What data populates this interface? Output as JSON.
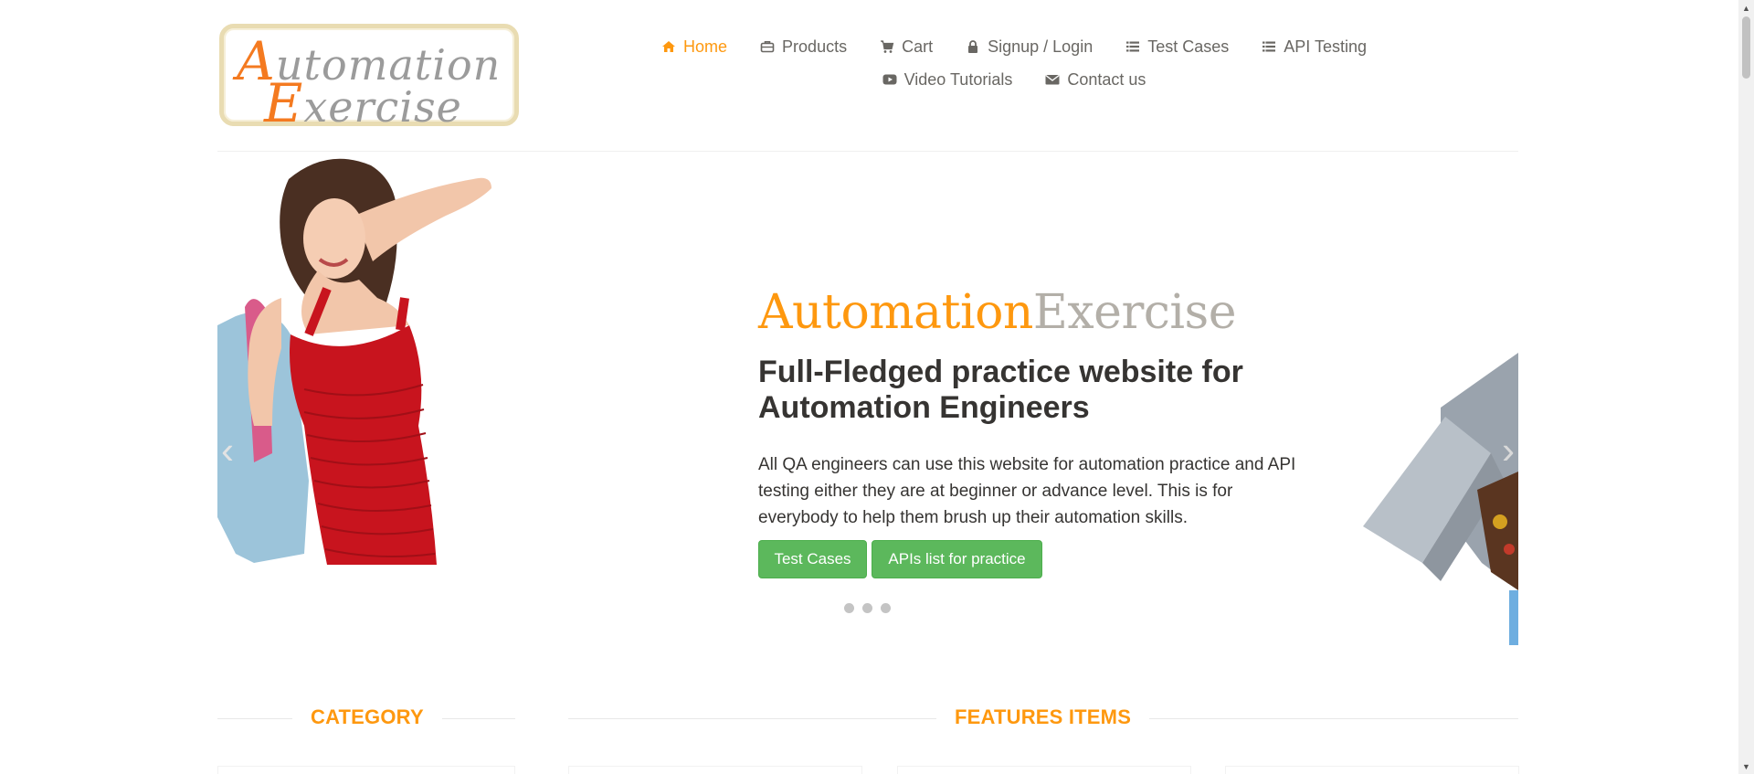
{
  "logo": {
    "line1_cap": "A",
    "line1_rest": "utomation",
    "line2_cap": "E",
    "line2_rest": "xercise"
  },
  "nav": {
    "row1": [
      {
        "label": "Home",
        "icon": "home-icon",
        "active": true
      },
      {
        "label": "Products",
        "icon": "briefcase-icon"
      },
      {
        "label": "Cart",
        "icon": "cart-icon"
      },
      {
        "label": "Signup / Login",
        "icon": "lock-icon"
      },
      {
        "label": "Test Cases",
        "icon": "list-icon"
      },
      {
        "label": "API Testing",
        "icon": "list-icon"
      }
    ],
    "row2": [
      {
        "label": "Video Tutorials",
        "icon": "youtube-icon"
      },
      {
        "label": "Contact us",
        "icon": "envelope-icon"
      }
    ]
  },
  "slider": {
    "brand_a": "Automation",
    "brand_b": "Exercise",
    "headline": "Full-Fledged practice website for Automation Engineers",
    "description": "All QA engineers can use this website for automation practice and API testing either they are at beginner or advance level. This is for everybody to help them brush up their automation skills.",
    "btn_test_cases": "Test Cases",
    "btn_apis": "APIs list for practice",
    "prev_arrow": "‹",
    "next_arrow": "›"
  },
  "sections": {
    "category": "CATEGORY",
    "features": "FEATURES ITEMS"
  },
  "colors": {
    "accent": "#fe980f",
    "button": "#5cb85c",
    "text": "#696763"
  }
}
